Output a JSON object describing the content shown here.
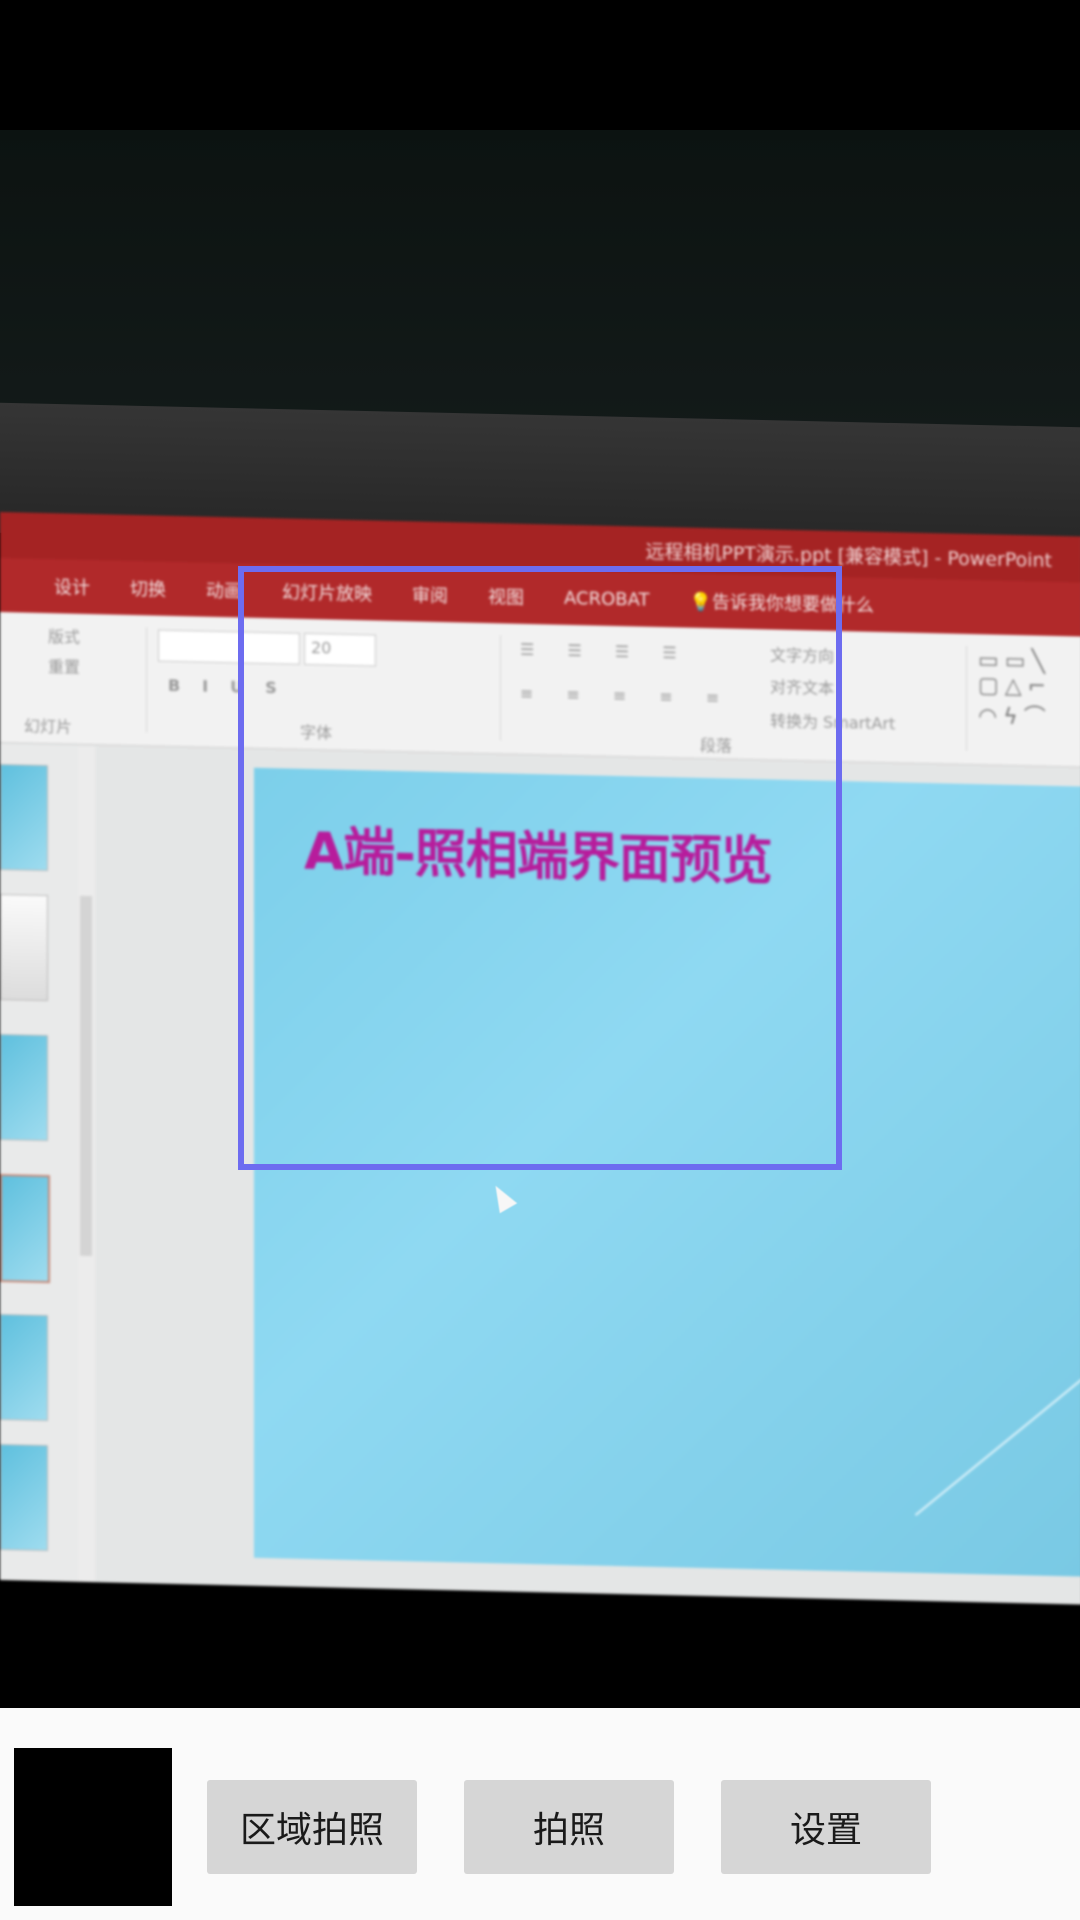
{
  "ppt": {
    "window_title": "远程相机PPT演示.ppt [兼容模式] - PowerPoint",
    "tabs": [
      "设计",
      "切换",
      "动画",
      "幻灯片放映",
      "审阅",
      "视图",
      "ACROBAT",
      "告诉我你想要做什么"
    ],
    "ribbon": {
      "layout": "版式",
      "reset": "重置",
      "section_slides": "幻灯片",
      "font_size": "20",
      "section_font": "字体",
      "section_paragraph": "段落",
      "text_direction": "文字方向",
      "align_text": "对齐文本",
      "smartart": "转换为 SmartArt"
    },
    "slide_title": "A端-照相端界面预览"
  },
  "controls": {
    "region_photo": "区域拍照",
    "photo": "拍照",
    "settings": "设置"
  }
}
